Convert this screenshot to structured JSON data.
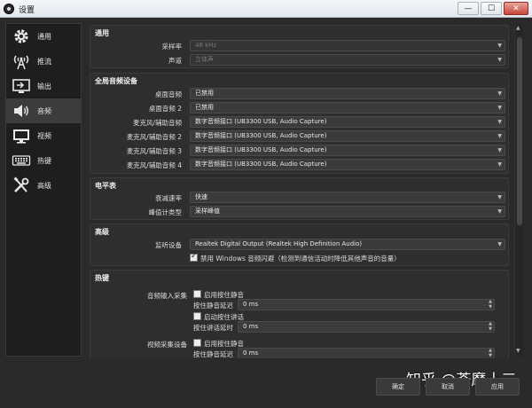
{
  "window": {
    "title": "设置",
    "minimize": "—",
    "maximize": "☐",
    "close": "✕"
  },
  "sidebar": {
    "items": [
      {
        "label": "通用",
        "icon": "gear-icon"
      },
      {
        "label": "推流",
        "icon": "broadcast-icon"
      },
      {
        "label": "输出",
        "icon": "output-icon"
      },
      {
        "label": "音频",
        "icon": "speaker-icon",
        "active": true
      },
      {
        "label": "视频",
        "icon": "monitor-icon"
      },
      {
        "label": "热键",
        "icon": "keyboard-icon"
      },
      {
        "label": "高级",
        "icon": "tools-icon"
      }
    ]
  },
  "general": {
    "title": "通用",
    "sample_rate_label": "采样率",
    "sample_rate_value": "48 kHz",
    "channels_label": "声道",
    "channels_value": "立体声"
  },
  "global_audio": {
    "title": "全局音频设备",
    "rows": [
      {
        "label": "桌面音频",
        "value": "已禁用"
      },
      {
        "label": "桌面音频 2",
        "value": "已禁用"
      },
      {
        "label": "麦克风/辅助音频",
        "value": "数字音频接口 (UB3300 USB, Audio Capture)"
      },
      {
        "label": "麦克风/辅助音频 2",
        "value": "数字音频接口 (UB3300 USB, Audio Capture)"
      },
      {
        "label": "麦克风/辅助音频 3",
        "value": "数字音频接口 (UB3300 USB, Audio Capture)"
      },
      {
        "label": "麦克风/辅助音频 4",
        "value": "数字音频接口 (UB3300 USB, Audio Capture)"
      }
    ]
  },
  "meters": {
    "title": "电平表",
    "decay_label": "衰减速率",
    "decay_value": "快速",
    "peak_label": "峰值计类型",
    "peak_value": "采样峰值"
  },
  "advanced": {
    "title": "高级",
    "monitor_label": "监听设备",
    "monitor_value": "Realtek Digital Output (Realtek High Definition Audio)",
    "ducking_label": "禁用 Windows 音频闪避（检测到通信活动时降低其他声音的音量）"
  },
  "hotkeys": {
    "title": "热键",
    "group1_label": "音频输入采集",
    "group2_label": "视频采集设备",
    "push_to_mute": "启用按住静音",
    "push_to_mute_delay": "按住静音延迟",
    "push_to_talk": "启动按住讲话",
    "push_to_talk_delay": "按住讲话延时",
    "delay_value": "0 ms"
  },
  "footer": {
    "ok": "确定",
    "cancel": "取消",
    "apply": "应用"
  },
  "watermark": "知乎 @荼靡十三"
}
